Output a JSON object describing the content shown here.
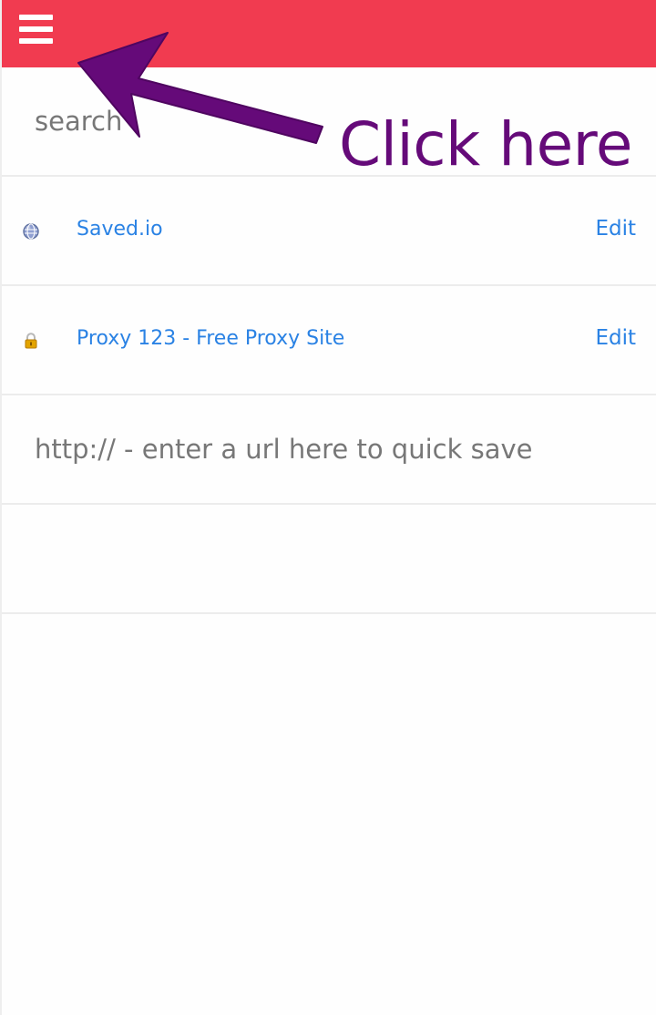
{
  "header": {
    "menu_icon": "hamburger-menu-icon",
    "bar_color": "#f13b50"
  },
  "search": {
    "placeholder": "search"
  },
  "bookmarks": [
    {
      "icon": "globe-icon",
      "title": "Saved.io",
      "edit_label": "Edit"
    },
    {
      "icon": "lock-icon",
      "title": "Proxy 123 - Free Proxy Site",
      "edit_label": "Edit"
    }
  ],
  "quick_save": {
    "placeholder": "http:// - enter a url here to quick save"
  },
  "annotation": {
    "text": "Click here",
    "color": "#650a79"
  },
  "colors": {
    "link": "#2a82e4",
    "placeholder": "#777777"
  }
}
